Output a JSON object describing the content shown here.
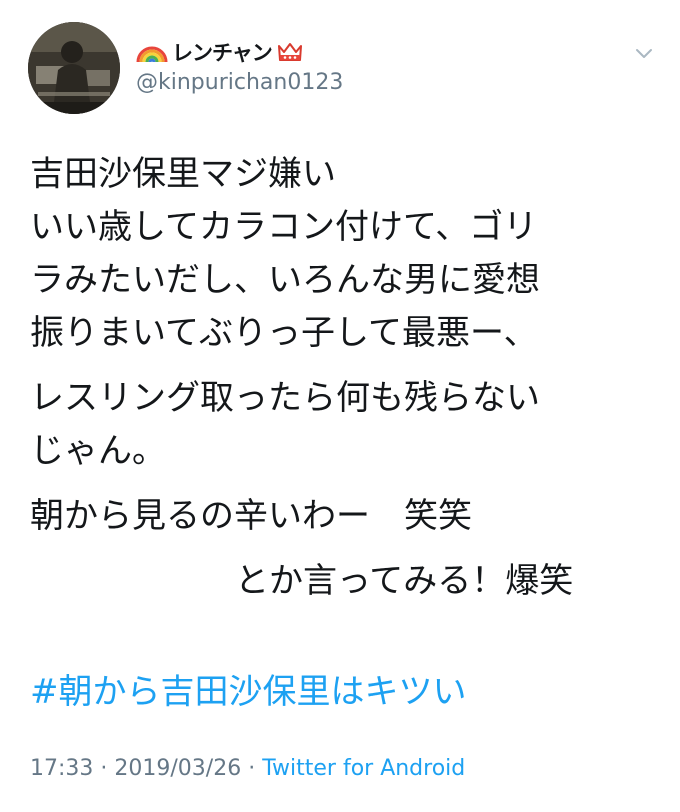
{
  "user": {
    "display_name": "レンチャン",
    "handle": "@kinpurichan0123",
    "name_prefix_icon": "rainbow-icon",
    "name_suffix_icon": "crown-icon"
  },
  "menu": {
    "icon": "chevron-down-icon"
  },
  "tweet": {
    "lines": [
      "吉田沙保里マジ嫌い",
      "いい歳してカラコン付けて、ゴリ",
      "ラみたいだし、いろんな男に愛想",
      "振りまいてぶりっ子して最悪ー、",
      "レスリング取ったら何も残らない",
      "じゃん。",
      "朝から見るの辛いわー　笑笑",
      "とか言ってみる！爆笑"
    ],
    "hashtag": "#朝から吉田沙保里はキツい"
  },
  "meta": {
    "time": "17:33",
    "separator": "·",
    "date": "2019/03/26",
    "client": "Twitter for Android"
  },
  "colors": {
    "text": "#14171a",
    "secondary": "#657786",
    "link": "#1da1f2"
  }
}
